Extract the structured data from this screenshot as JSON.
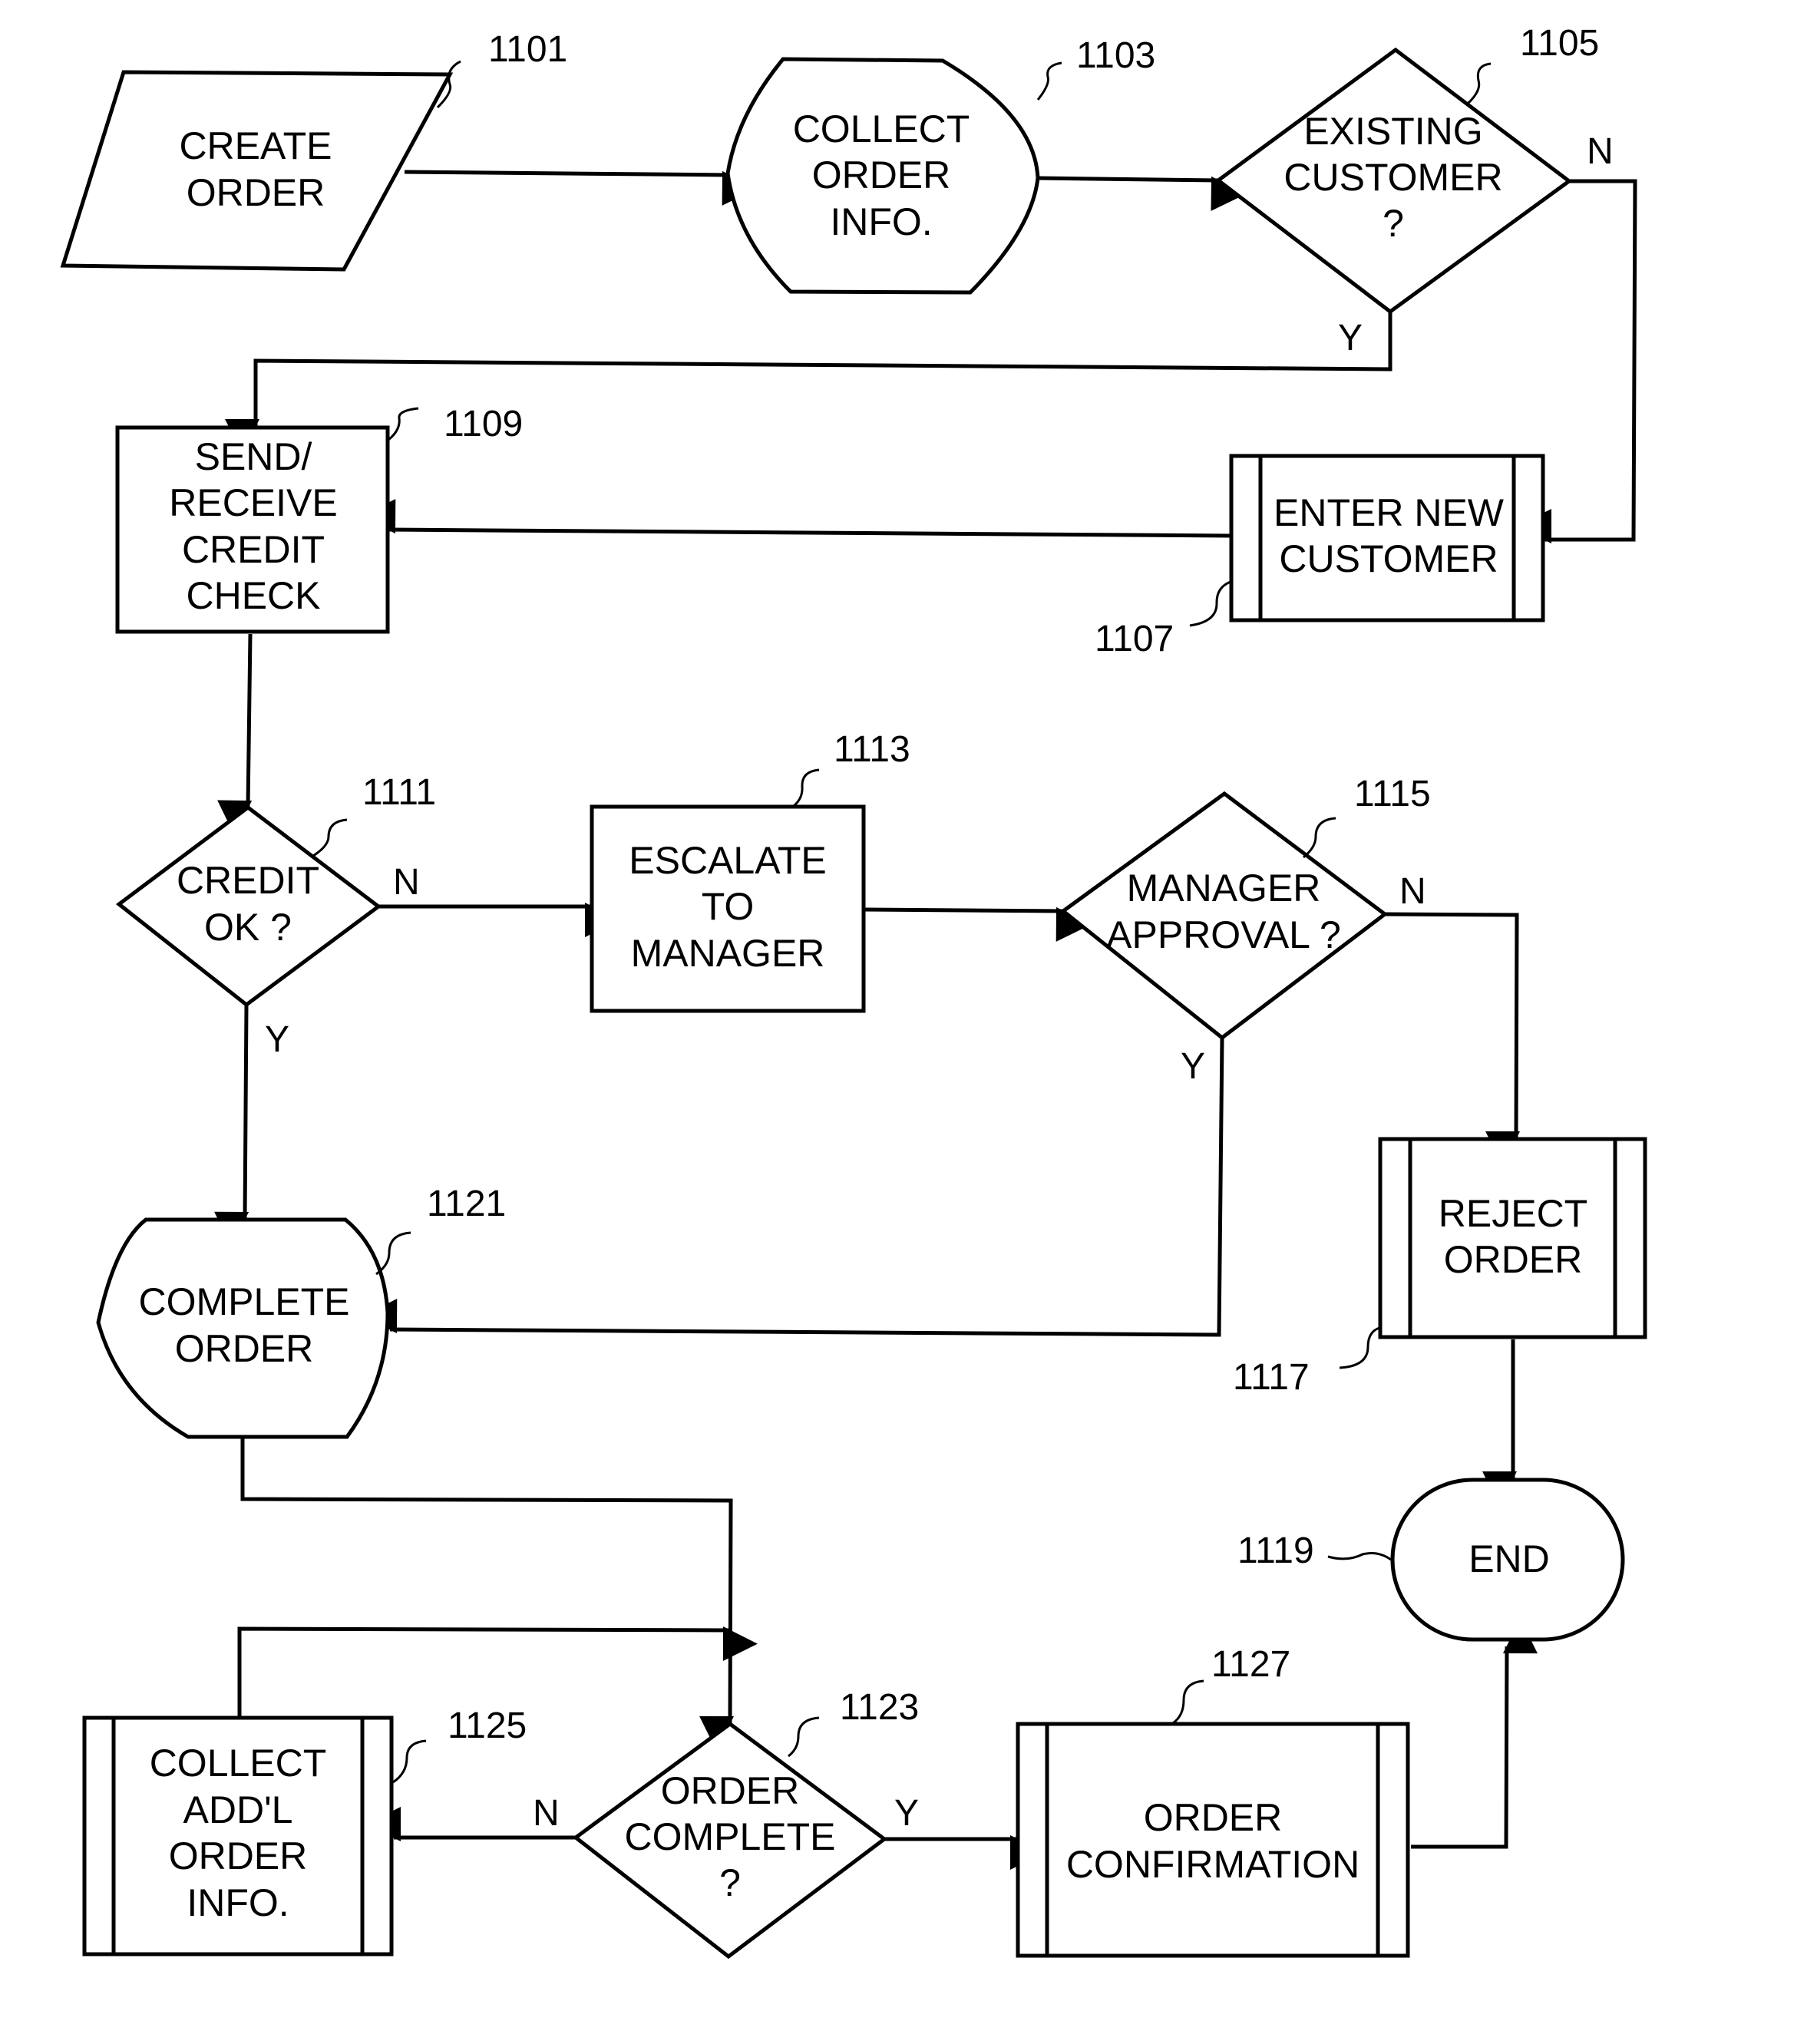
{
  "diagram": {
    "type": "flowchart",
    "nodes": {
      "n1101": {
        "ref": "1101",
        "shape": "parallelogram",
        "lines": [
          "CREATE",
          "ORDER"
        ]
      },
      "n1103": {
        "ref": "1103",
        "shape": "display",
        "lines": [
          "COLLECT",
          "ORDER",
          "INFO."
        ]
      },
      "n1105": {
        "ref": "1105",
        "shape": "decision",
        "lines": [
          "EXISTING",
          "CUSTOMER",
          "?"
        ]
      },
      "n1107": {
        "ref": "1107",
        "shape": "predefined-process",
        "lines": [
          "ENTER NEW",
          "CUSTOMER"
        ]
      },
      "n1109": {
        "ref": "1109",
        "shape": "process",
        "lines": [
          "SEND/",
          "RECEIVE",
          "CREDIT",
          "CHECK"
        ]
      },
      "n1111": {
        "ref": "1111",
        "shape": "decision",
        "lines": [
          "CREDIT",
          "OK ?"
        ]
      },
      "n1113": {
        "ref": "1113",
        "shape": "process",
        "lines": [
          "ESCALATE",
          "TO",
          "MANAGER"
        ]
      },
      "n1115": {
        "ref": "1115",
        "shape": "decision",
        "lines": [
          "MANAGER",
          "APPROVAL ?"
        ]
      },
      "n1117": {
        "ref": "1117",
        "shape": "predefined-process",
        "lines": [
          "REJECT",
          "ORDER"
        ]
      },
      "n1119": {
        "ref": "1119",
        "shape": "terminator",
        "lines": [
          "END"
        ]
      },
      "n1121": {
        "ref": "1121",
        "shape": "display",
        "lines": [
          "COMPLETE",
          "ORDER"
        ]
      },
      "n1123": {
        "ref": "1123",
        "shape": "decision",
        "lines": [
          "ORDER",
          "COMPLETE",
          "?"
        ]
      },
      "n1125": {
        "ref": "1125",
        "shape": "predefined-process",
        "lines": [
          "COLLECT",
          "ADD'L",
          "ORDER",
          "INFO."
        ]
      },
      "n1127": {
        "ref": "1127",
        "shape": "predefined-process",
        "lines": [
          "ORDER",
          "CONFIRMATION"
        ]
      }
    },
    "edges": [
      {
        "from": "1101",
        "to": "1103",
        "label": ""
      },
      {
        "from": "1103",
        "to": "1105",
        "label": ""
      },
      {
        "from": "1105",
        "to": "1109",
        "label": "Y"
      },
      {
        "from": "1105",
        "to": "1107",
        "label": "N"
      },
      {
        "from": "1107",
        "to": "1109",
        "label": ""
      },
      {
        "from": "1109",
        "to": "1111",
        "label": ""
      },
      {
        "from": "1111",
        "to": "1113",
        "label": "N"
      },
      {
        "from": "1111",
        "to": "1121",
        "label": "Y"
      },
      {
        "from": "1113",
        "to": "1115",
        "label": ""
      },
      {
        "from": "1115",
        "to": "1117",
        "label": "N"
      },
      {
        "from": "1115",
        "to": "1121",
        "label": "Y"
      },
      {
        "from": "1117",
        "to": "1119",
        "label": ""
      },
      {
        "from": "1121",
        "to": "1123",
        "label": ""
      },
      {
        "from": "1123",
        "to": "1125",
        "label": "N"
      },
      {
        "from": "1123",
        "to": "1127",
        "label": "Y"
      },
      {
        "from": "1125",
        "to": "1123",
        "label": ""
      },
      {
        "from": "1127",
        "to": "1119",
        "label": ""
      }
    ],
    "branch_labels": {
      "e1105_n": "N",
      "e1105_y": "Y",
      "e1111_n": "N",
      "e1111_y": "Y",
      "e1115_n": "N",
      "e1115_y": "Y",
      "e1123_n": "N",
      "e1123_y": "Y"
    }
  }
}
